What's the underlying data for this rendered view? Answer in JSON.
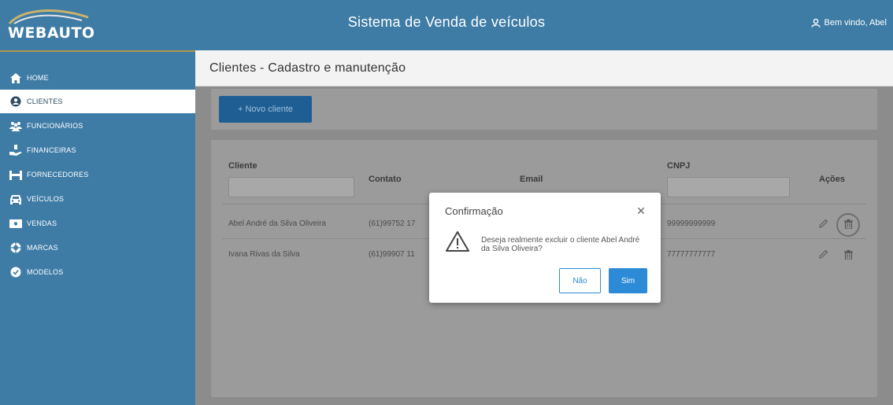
{
  "header": {
    "logo_text": "WEBAUTO",
    "title": "Sistema de Venda de veículos",
    "user_label": "Bem vindo, Abel"
  },
  "sidebar": {
    "items": [
      {
        "label": "HOME",
        "icon": "home-icon"
      },
      {
        "label": "CLIENTES",
        "icon": "user-circle-icon",
        "active": true
      },
      {
        "label": "FUNCIONÁRIOS",
        "icon": "users-icon"
      },
      {
        "label": "FINANCEIRAS",
        "icon": "hand-coins-icon"
      },
      {
        "label": "FORNECEDORES",
        "icon": "dolly-icon"
      },
      {
        "label": "VEÍCULOS",
        "icon": "car-icon"
      },
      {
        "label": "VENDAS",
        "icon": "money-bill-icon"
      },
      {
        "label": "MARCAS",
        "icon": "badge-icon"
      },
      {
        "label": "MODELOS",
        "icon": "circle-icon"
      }
    ]
  },
  "page": {
    "title": "Clientes - Cadastro e manutenção",
    "new_button": "+ Novo cliente"
  },
  "table": {
    "columns": [
      "Cliente",
      "Contato",
      "Email",
      "CNPJ",
      "Ações"
    ],
    "rows": [
      {
        "cliente": "Abel André da Silva Oliveira",
        "contato": "(61)99752 17",
        "cnpj": "99999999999"
      },
      {
        "cliente": "Ivana Rivas da Silva",
        "contato": "(61)99907 11",
        "cnpj": "77777777777"
      }
    ]
  },
  "modal": {
    "title": "Confirmação",
    "message": "Deseja realmente excluir o cliente Abel André da Silva Oliveira?",
    "no_label": "Não",
    "yes_label": "Sim"
  },
  "colors": {
    "brand": "#3e7ca6",
    "primary_button": "#2d8ad6",
    "accent_line": "#b0974a"
  }
}
